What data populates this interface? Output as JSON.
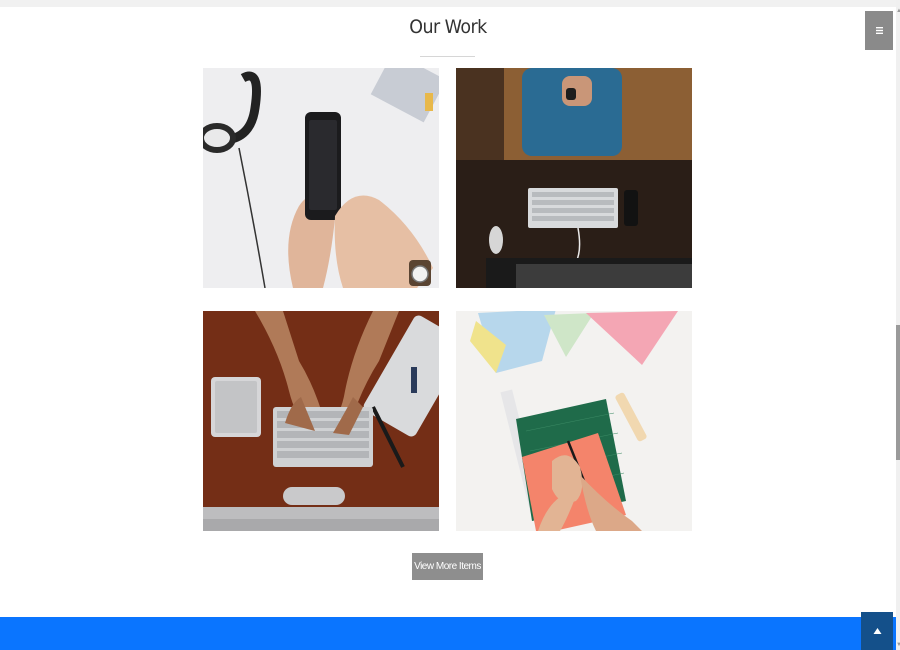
{
  "section": {
    "title": "Our Work"
  },
  "portfolio": {
    "items": [
      {
        "subject": "hands holding a smartphone beside headphones on a white desk"
      },
      {
        "subject": "person at a dark desk with keyboard, mouse and phone"
      },
      {
        "subject": "hands typing on a keyboard on a wooden desk"
      },
      {
        "subject": "hand writing on pink paper over a green cutting mat with pastel papers"
      }
    ]
  },
  "actions": {
    "view_more_label": "View More Items"
  },
  "icons": {
    "menu": "hamburger-icon",
    "back_to_top": "chevron-up-icon"
  },
  "colors": {
    "accent": "#0a75ff",
    "button": "#8e8e8e",
    "menu_button": "#8a8a8a",
    "back_to_top": "#14508a"
  }
}
